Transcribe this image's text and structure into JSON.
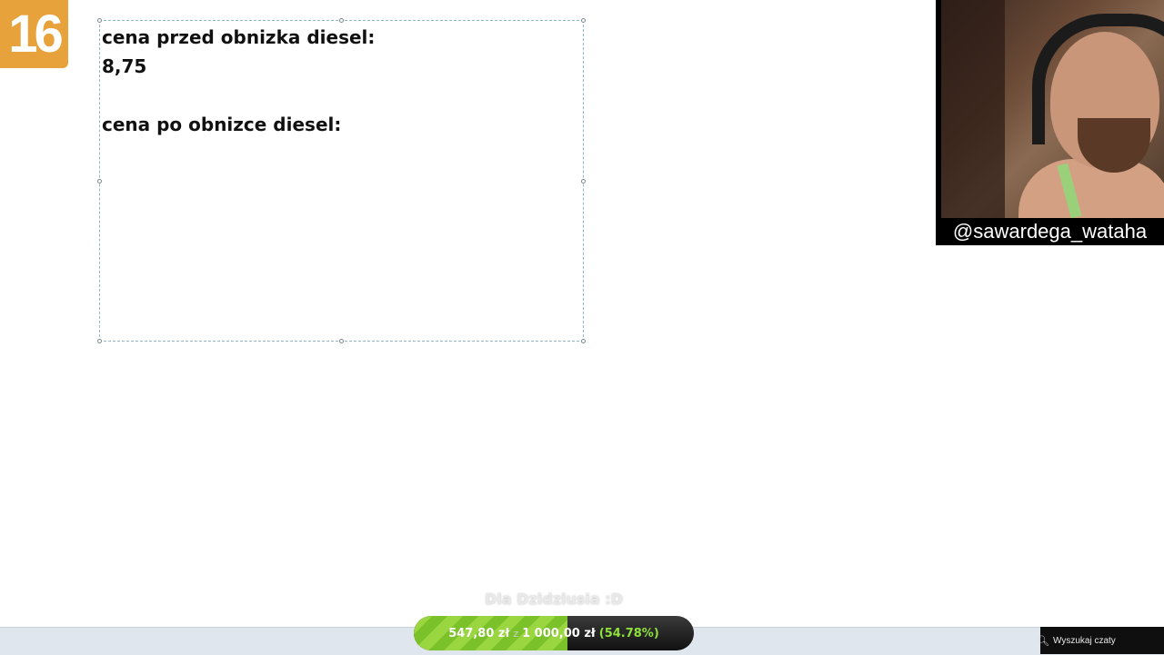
{
  "logo": {
    "text": "16",
    "color": "#e8a23c"
  },
  "textbox": {
    "line1": "cena przed obnizka diesel:",
    "line2": "8,75",
    "line3": "cena po obnizce diesel:"
  },
  "webcam": {
    "handle": "@sawardega_wataha"
  },
  "goal": {
    "title": "Dla Dzidziusia :D",
    "current": "547,80 zł",
    "separator": "z",
    "target": "1 000,00 zł",
    "percent_label": "(54.78%)",
    "progress_fraction": 0.5478
  },
  "chat_search": {
    "label": "Wyszukaj czaty",
    "icon": "search-icon"
  }
}
